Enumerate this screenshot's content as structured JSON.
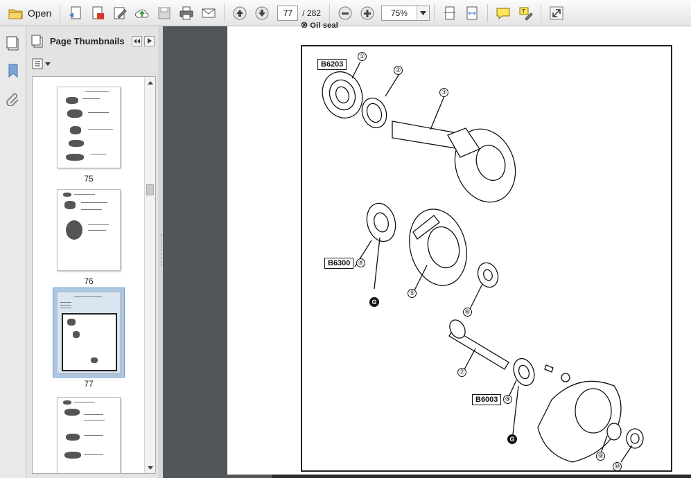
{
  "toolbar": {
    "open_label": "Open",
    "current_page": "77",
    "total_pages": "/ 282",
    "zoom": "75%",
    "icons": [
      "open-folder-icon",
      "create-pdf-icon",
      "edit-pdf-icon",
      "sign-icon",
      "upload-cloud-icon",
      "save-icon",
      "print-icon",
      "email-icon",
      "prev-page-icon",
      "next-page-icon",
      "zoom-out-icon",
      "zoom-in-icon",
      "fit-page-icon",
      "fit-width-icon",
      "comment-icon",
      "highlight-icon",
      "expand-icon"
    ]
  },
  "sidebar": {
    "title": "Page Thumbnails",
    "thumbnails": [
      {
        "number": "75"
      },
      {
        "number": "76"
      },
      {
        "number": "77",
        "selected": true
      },
      {
        "number": ""
      }
    ]
  },
  "document": {
    "header_text": "⑩ Oil seal",
    "callouts": {
      "b1": "B6203",
      "b2": "B6300",
      "b3": "B6003"
    },
    "part_numbers": [
      "①",
      "②",
      "③",
      "④",
      "⑤",
      "⑥",
      "⑦",
      "⑧",
      "⑨",
      "⑩"
    ],
    "grease_badge": "G"
  },
  "colors": {
    "doc_background": "#525659",
    "selection": "#aac7e4",
    "toolbar": "#f0f0f0"
  }
}
